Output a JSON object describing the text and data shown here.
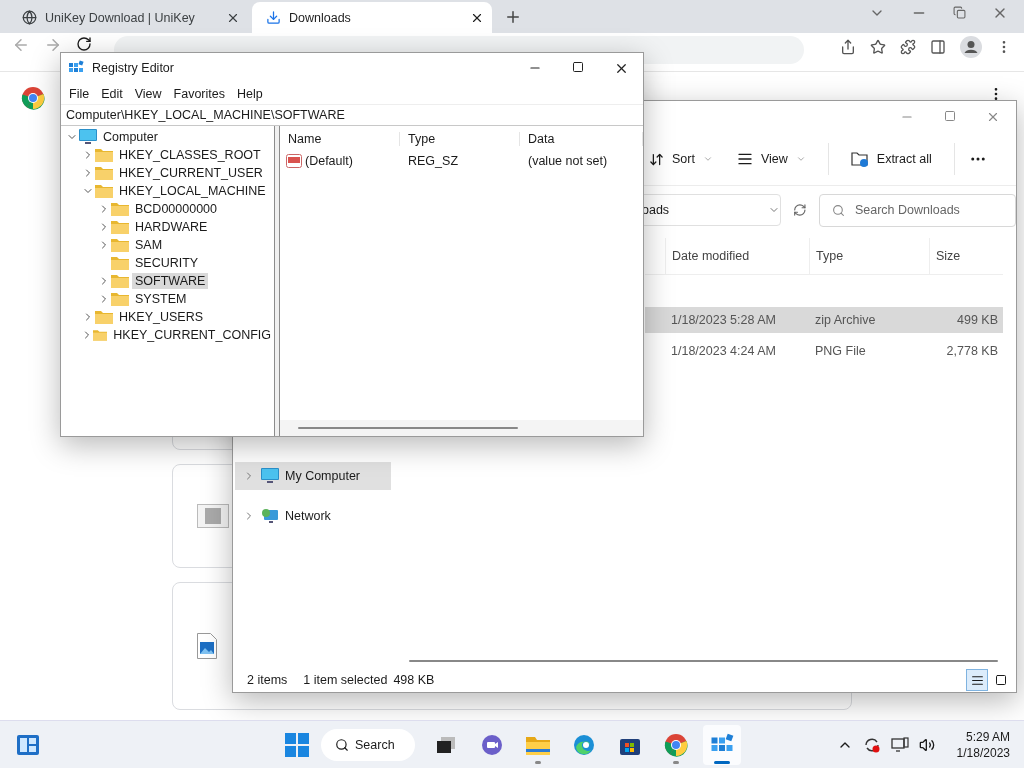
{
  "browser": {
    "tabs": [
      {
        "title": "UniKey Download | UniKey",
        "kind": "site",
        "selected": false
      },
      {
        "title": "Downloads",
        "kind": "downloads",
        "selected": true
      }
    ],
    "downloads": [
      {
        "kind": "hidden"
      },
      {
        "kind": "video"
      },
      {
        "kind": "image"
      }
    ]
  },
  "registry_editor": {
    "title": "Registry Editor",
    "menu": [
      "File",
      "Edit",
      "View",
      "Favorites",
      "Help"
    ],
    "address": "Computer\\HKEY_LOCAL_MACHINE\\SOFTWARE",
    "tree": [
      {
        "label": "Computer",
        "kind": "computer",
        "expandable": true,
        "expanded": true,
        "selected": false,
        "children": [
          {
            "label": "HKEY_CLASSES_ROOT",
            "kind": "folder",
            "expandable": true,
            "expanded": false,
            "selected": false
          },
          {
            "label": "HKEY_CURRENT_USER",
            "kind": "folder",
            "expandable": true,
            "expanded": false,
            "selected": false
          },
          {
            "label": "HKEY_LOCAL_MACHINE",
            "kind": "folder",
            "expandable": true,
            "expanded": true,
            "selected": false,
            "children": [
              {
                "label": "BCD00000000",
                "kind": "folder",
                "expandable": true,
                "expanded": false,
                "selected": false
              },
              {
                "label": "HARDWARE",
                "kind": "folder",
                "expandable": true,
                "expanded": false,
                "selected": false
              },
              {
                "label": "SAM",
                "kind": "folder",
                "expandable": true,
                "expanded": false,
                "selected": false
              },
              {
                "label": "SECURITY",
                "kind": "folder",
                "expandable": false,
                "expanded": false,
                "selected": false
              },
              {
                "label": "SOFTWARE",
                "kind": "folder",
                "expandable": true,
                "expanded": false,
                "selected": true
              },
              {
                "label": "SYSTEM",
                "kind": "folder",
                "expandable": true,
                "expanded": false,
                "selected": false
              }
            ]
          },
          {
            "label": "HKEY_USERS",
            "kind": "folder",
            "expandable": true,
            "expanded": false,
            "selected": false
          },
          {
            "label": "HKEY_CURRENT_CONFIG",
            "kind": "folder",
            "expandable": true,
            "expanded": false,
            "selected": false
          }
        ]
      }
    ],
    "columns": [
      "Name",
      "Type",
      "Data"
    ],
    "values": [
      {
        "name": "(Default)",
        "type": "REG_SZ",
        "data": "(value not set)"
      }
    ]
  },
  "file_explorer": {
    "toolbar": [
      {
        "label": "Sort",
        "kind": "sort"
      },
      {
        "label": "View",
        "kind": "view"
      },
      {
        "label": "Extract all",
        "kind": "extract"
      }
    ],
    "address": "oads",
    "search": {
      "placeholder": "Search Downloads"
    },
    "columns": [
      "Date modified",
      "Type",
      "Size"
    ],
    "rows": [
      {
        "date": "1/18/2023 5:28 AM",
        "type": "zip Archive",
        "size": "499 KB",
        "selected": true
      },
      {
        "date": "1/18/2023 4:24 AM",
        "type": "PNG File",
        "size": "2,778 KB",
        "selected": false
      }
    ],
    "nav": [
      {
        "label": "My Computer",
        "kind": "computer",
        "selected": true
      },
      {
        "label": "Network",
        "kind": "network",
        "selected": false
      }
    ],
    "status": {
      "count": "2 items",
      "selection": "1 item selected",
      "size": "498 KB"
    },
    "view_modes": [
      {
        "kind": "details",
        "selected": true
      },
      {
        "kind": "tiles",
        "selected": false
      }
    ]
  },
  "taskbar": {
    "search": "Search",
    "apps": [
      {
        "kind": "taskview",
        "running": false,
        "active": false
      },
      {
        "kind": "chat",
        "running": false,
        "active": false
      },
      {
        "kind": "files",
        "running": true,
        "active": false
      },
      {
        "kind": "edge",
        "running": false,
        "active": false
      },
      {
        "kind": "store",
        "running": false,
        "active": false
      },
      {
        "kind": "chrome",
        "running": true,
        "active": false
      },
      {
        "kind": "regedit",
        "running": true,
        "active": true
      }
    ],
    "time": "5:29 AM",
    "date": "1/18/2023"
  }
}
